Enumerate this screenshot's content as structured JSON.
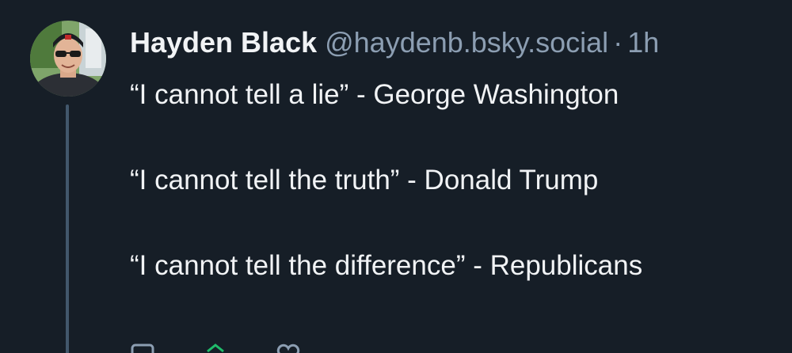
{
  "post": {
    "author": {
      "display_name": "Hayden Black",
      "handle": "@haydenb.bsky.social"
    },
    "separator": "·",
    "timestamp": "1h",
    "text_paragraphs": [
      "“I cannot tell a lie” - George Washington",
      "“I cannot tell the truth” - Donald Trump",
      "“I cannot tell the difference” - Republicans"
    ],
    "actions": {
      "reply_icon": "reply-icon",
      "repost_icon": "repost-icon",
      "like_icon": "heart-icon"
    }
  },
  "colors": {
    "background": "#161e27",
    "text_primary": "#f1f3f5",
    "text_secondary": "#8c9eb2",
    "thread_line": "#42576c",
    "repost_active": "#20bc6b"
  }
}
